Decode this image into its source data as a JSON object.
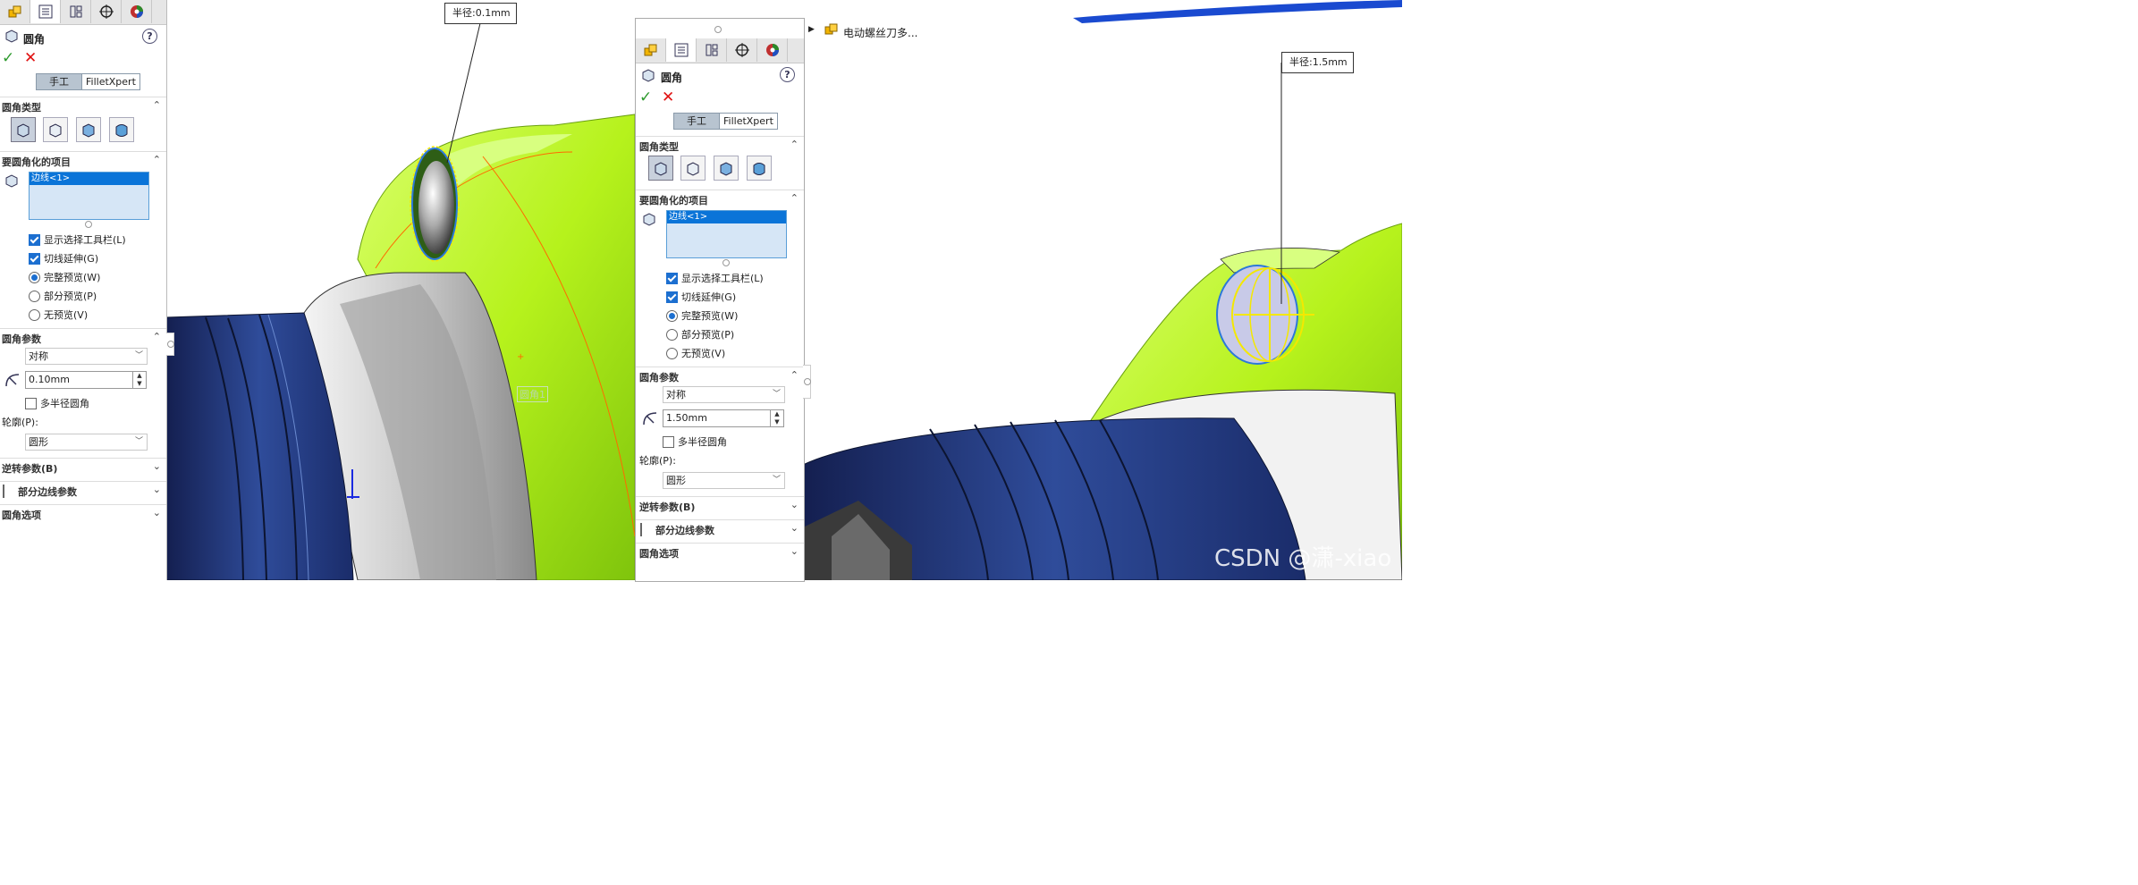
{
  "colors": {
    "accent": "#0a74d8",
    "ok": "#2e9a2e",
    "cancel": "#e01010",
    "fillet_face": "#b6f21c",
    "body_blue": "#1f3a78"
  },
  "left_panel": {
    "tab_icons": [
      "feature-manager-icon",
      "property-manager-icon",
      "configuration-manager-icon",
      "dimxpert-icon",
      "display-manager-icon"
    ],
    "title": "圆角",
    "help": "?",
    "mode_tabs": [
      "手工",
      "FilletXpert"
    ],
    "fillet_type": {
      "header": "圆角类型"
    },
    "items": {
      "header": "要圆角化的项目",
      "list": [
        "边线<1>"
      ]
    },
    "options": [
      {
        "label": "显示选择工具栏(L)",
        "kind": "checkbox",
        "checked": true
      },
      {
        "label": "切线延伸(G)",
        "kind": "checkbox",
        "checked": true
      },
      {
        "label": "完整预览(W)",
        "kind": "radio",
        "checked": true
      },
      {
        "label": "部分预览(P)",
        "kind": "radio",
        "checked": false
      },
      {
        "label": "无预览(V)",
        "kind": "radio",
        "checked": false
      }
    ],
    "params": {
      "header": "圆角参数",
      "method": "对称",
      "radius": "0.10mm",
      "multi_radius": "多半径圆角",
      "profile_label": "轮廓(P):",
      "profile": "圆形"
    },
    "collapsed": [
      "逆转参数(B)",
      "部分边线参数",
      "圆角选项"
    ]
  },
  "right_panel": {
    "title": "圆角",
    "help": "?",
    "mode_tabs": [
      "手工",
      "FilletXpert"
    ],
    "fillet_type": {
      "header": "圆角类型"
    },
    "items": {
      "header": "要圆角化的项目",
      "list": [
        "边线<1>"
      ]
    },
    "options": [
      {
        "label": "显示选择工具栏(L)",
        "kind": "checkbox",
        "checked": true
      },
      {
        "label": "切线延伸(G)",
        "kind": "checkbox",
        "checked": true
      },
      {
        "label": "完整预览(W)",
        "kind": "radio",
        "checked": true
      },
      {
        "label": "部分预览(P)",
        "kind": "radio",
        "checked": false
      },
      {
        "label": "无预览(V)",
        "kind": "radio",
        "checked": false
      }
    ],
    "params": {
      "header": "圆角参数",
      "method": "对称",
      "radius": "1.50mm",
      "multi_radius": "多半径圆角",
      "profile_label": "轮廓(P):",
      "profile": "圆形"
    },
    "collapsed": [
      "逆转参数(B)",
      "部分边线参数",
      "圆角选项"
    ]
  },
  "viewport": {
    "left_callout": {
      "label": "半径:",
      "value": "0.1mm"
    },
    "right_callout": {
      "label": "半径:",
      "value": "1.5mm"
    },
    "tree_node": "电动螺丝刀多...",
    "ghost_label": "圆角1",
    "watermark": "CSDN @潇-xiao"
  }
}
